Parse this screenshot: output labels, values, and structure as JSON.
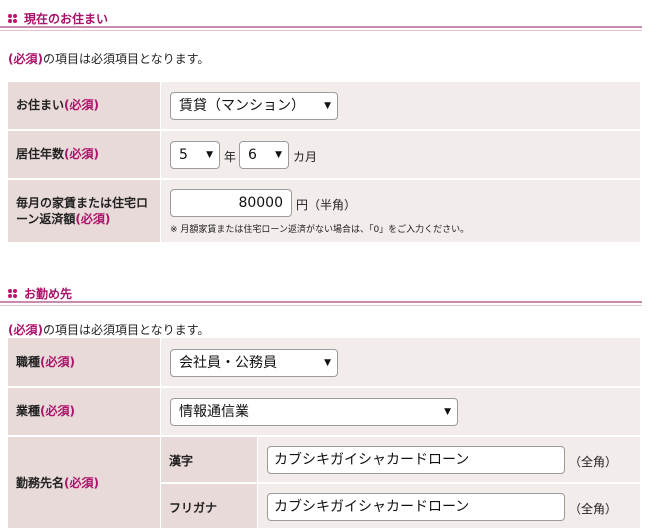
{
  "section1": {
    "title": "現在のお住まい",
    "note_req": "(必須)",
    "note_text": "の項目は必須項目となります。",
    "rows": {
      "residence": {
        "label": "お住まい",
        "req": "(必須)",
        "select_value": "賃貸（マンション）"
      },
      "years": {
        "label": "居住年数",
        "req": "(必須)",
        "years_value": "5",
        "years_unit": "年",
        "months_value": "6",
        "months_unit": "カ月"
      },
      "rent": {
        "label_line1": "毎月の家賃または住宅ロ",
        "label_line2": "ーン返済額",
        "req": "(必須)",
        "input_value": "80000",
        "unit": "円（半角）",
        "hint": "※ 月額家賃または住宅ローン返済がない場合は、「0」をご入力ください。"
      }
    }
  },
  "section2": {
    "title": "お勤め先",
    "note_req": "(必須)",
    "note_text": "の項目は必須項目となります。",
    "rows": {
      "job_type": {
        "label": "職種",
        "req": "(必須)",
        "select_value": "会社員・公務員"
      },
      "industry": {
        "label": "業種",
        "req": "(必須)",
        "select_value": "情報通信業"
      },
      "company": {
        "label": "勤務先名",
        "req": "(必須)",
        "kanji_label": "漢字",
        "kanji_value": "カブシキガイシャカードローン",
        "kanji_unit": "（全角）",
        "kana_label": "フリガナ",
        "kana_value": "カブシキガイシャカードローン",
        "kana_unit": "（全角）"
      }
    }
  },
  "icons": {
    "section_marker": "dots-icon",
    "dropdown": "triangle-down-icon"
  },
  "colors": {
    "accent": "#b0136c",
    "label_bg": "#e8dad8",
    "value_bg": "#f2ecea",
    "rule": "#c98ab0"
  }
}
